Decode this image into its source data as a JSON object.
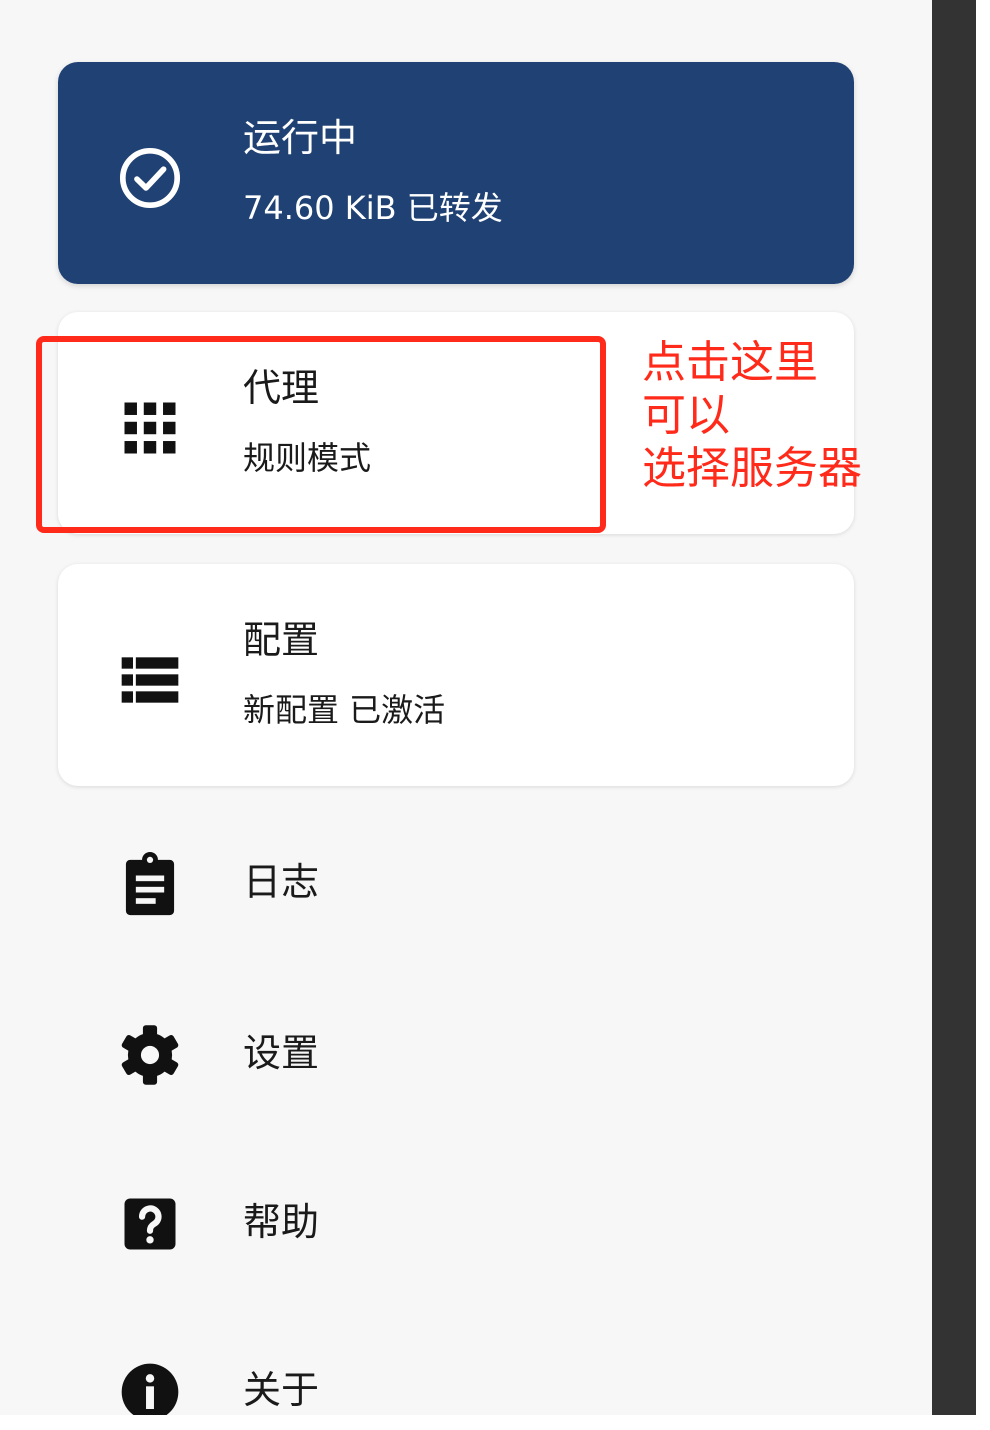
{
  "status_card": {
    "title": "运行中",
    "subtitle": "74.60 KiB 已转发",
    "icon": "check-circle-icon",
    "background": "#1f4173"
  },
  "proxy_card": {
    "title": "代理",
    "subtitle": "规则模式",
    "icon": "grid-apps-icon"
  },
  "profile_card": {
    "title": "配置",
    "subtitle": "新配置 已激活",
    "icon": "list-icon"
  },
  "annotation": {
    "lines": [
      "点击这里",
      "可以",
      "选择服务器"
    ],
    "color": "#ff2a1a"
  },
  "menu": {
    "items": [
      {
        "label": "日志",
        "icon": "clipboard-icon"
      },
      {
        "label": "设置",
        "icon": "gear-icon"
      },
      {
        "label": "帮助",
        "icon": "help-icon"
      },
      {
        "label": "关于",
        "icon": "info-icon"
      }
    ]
  }
}
